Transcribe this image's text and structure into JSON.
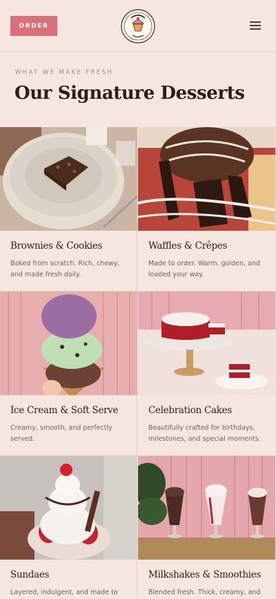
{
  "header": {
    "order_label": "ORDER",
    "logo": {
      "top_text": "TREATS 'N EATS",
      "bottom_text": "Desserts"
    }
  },
  "hero": {
    "eyebrow": "WHAT WE MAKE FRESH",
    "title": "Our Signature Desserts"
  },
  "items": [
    {
      "name": "Brownies & Cookies",
      "desc": "Baked from scratch. Rich, chewy, and made fresh daily."
    },
    {
      "name": "Waffles & Crêpes",
      "desc": "Made to order. Warm, golden, and loaded your way."
    },
    {
      "name": "Ice Cream & Soft Serve",
      "desc": "Creamy, smooth, and perfectly served."
    },
    {
      "name": "Celebration Cakes",
      "desc": "Beautifully crafted for birthdays, milestones, and special moments."
    },
    {
      "name": "Sundaes",
      "desc": "Layered, indulgent, and made to"
    },
    {
      "name": "Milkshakes & Smoothies",
      "desc": "Blended fresh. Thick, creamy, and"
    }
  ],
  "colors": {
    "background": "#f5e7e0",
    "accent": "#d9707b",
    "text": "#2a1e1c"
  }
}
